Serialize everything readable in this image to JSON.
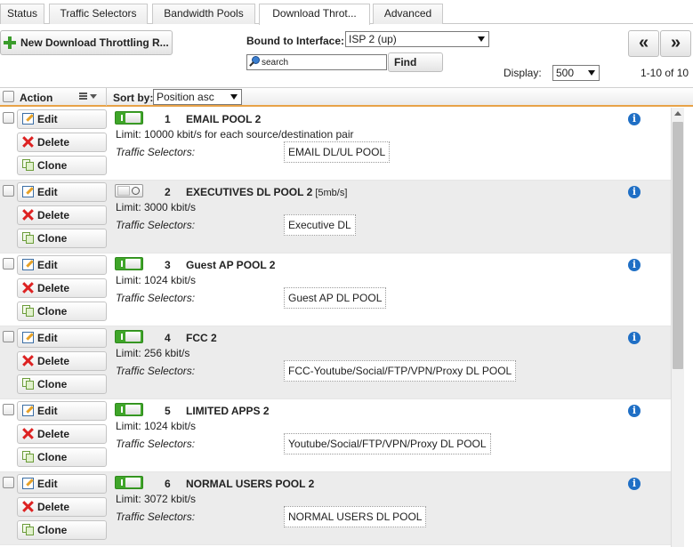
{
  "tabs": [
    {
      "label": "Status"
    },
    {
      "label": "Traffic Selectors"
    },
    {
      "label": "Bandwidth Pools"
    },
    {
      "label": "Download Throt..."
    },
    {
      "label": "Advanced"
    }
  ],
  "toolbar": {
    "new_button": "New Download Throttling R...",
    "bound_label": "Bound to Interface:",
    "interface_value": "ISP 2 (up)",
    "search_placeholder": "search",
    "search_value": "",
    "find_button": "Find",
    "prev_button": "«",
    "next_button": "»",
    "display_label": "Display:",
    "display_value": "500",
    "count": "1-10 of 10"
  },
  "table": {
    "action_header": "Action",
    "sort_label": "Sort by:",
    "sort_value": "Position asc",
    "edit_label": "Edit",
    "delete_label": "Delete",
    "clone_label": "Clone",
    "ts_label": "Traffic Selectors:",
    "info_glyph": "i",
    "rows": [
      {
        "num": "1",
        "name": "EMAIL POOL 2",
        "extra": "",
        "enabled": true,
        "limit": "Limit: 10000 kbit/s for each source/destination pair",
        "selector": "EMAIL DL/UL POOL"
      },
      {
        "num": "2",
        "name": "EXECUTIVES DL POOL 2",
        "extra": " [5mb/s]",
        "enabled": false,
        "limit": "Limit: 3000 kbit/s",
        "selector": "Executive DL"
      },
      {
        "num": "3",
        "name": "Guest AP POOL 2",
        "extra": "",
        "enabled": true,
        "limit": "Limit: 1024 kbit/s",
        "selector": "Guest AP DL POOL"
      },
      {
        "num": "4",
        "name": "FCC 2",
        "extra": "",
        "enabled": true,
        "limit": "Limit: 256 kbit/s",
        "selector": "FCC-Youtube/Social/FTP/VPN/Proxy DL POOL"
      },
      {
        "num": "5",
        "name": "LIMITED APPS 2",
        "extra": "",
        "enabled": true,
        "limit": "Limit: 1024 kbit/s",
        "selector": "Youtube/Social/FTP/VPN/Proxy DL POOL"
      },
      {
        "num": "6",
        "name": "NORMAL USERS POOL 2",
        "extra": "",
        "enabled": true,
        "limit": "Limit: 3072 kbit/s",
        "selector": "NORMAL USERS DL POOL"
      }
    ]
  }
}
